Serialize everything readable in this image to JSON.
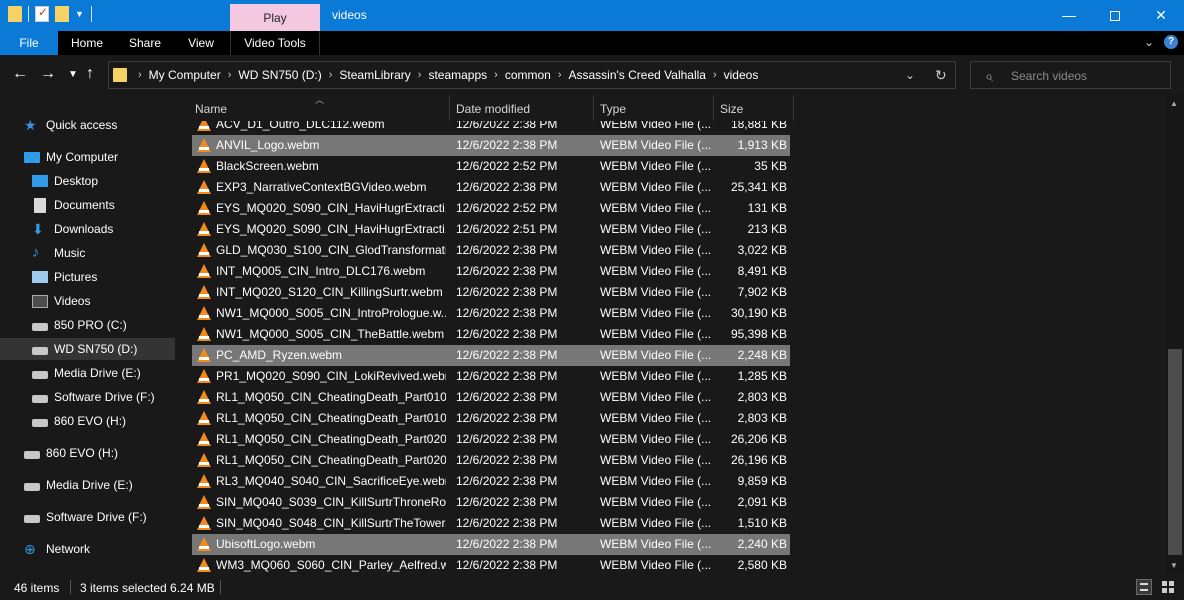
{
  "window": {
    "title": "videos",
    "context_tab": "Play",
    "min_label": "—",
    "close_label": "✕"
  },
  "ribbon": {
    "tabs": [
      "File",
      "Home",
      "Share",
      "View",
      "Video Tools"
    ]
  },
  "address": {
    "crumbs": [
      "My Computer",
      "WD SN750 (D:)",
      "SteamLibrary",
      "steamapps",
      "common",
      "Assassin's Creed Valhalla",
      "videos"
    ]
  },
  "search": {
    "placeholder": "Search videos"
  },
  "nav": {
    "quick_access": "Quick access",
    "my_computer": "My Computer",
    "desktop": "Desktop",
    "documents": "Documents",
    "downloads": "Downloads",
    "music": "Music",
    "pictures": "Pictures",
    "videos": "Videos",
    "drive_c": "850 PRO (C:)",
    "drive_d": "WD SN750 (D:)",
    "drive_e": "Media Drive (E:)",
    "drive_f": "Software Drive (F:)",
    "drive_h": "860 EVO (H:)",
    "ext_h": "860 EVO (H:)",
    "ext_e": "Media Drive (E:)",
    "ext_f": "Software Drive (F:)",
    "network": "Network"
  },
  "columns": {
    "name": "Name",
    "date": "Date modified",
    "type": "Type",
    "size": "Size"
  },
  "files": [
    {
      "name": "ACV_D1_Outro_DLC112.webm",
      "date": "12/6/2022 2:38 PM",
      "type": "WEBM Video File (...",
      "size": "18,881 KB",
      "selected": false
    },
    {
      "name": "ANVIL_Logo.webm",
      "date": "12/6/2022 2:38 PM",
      "type": "WEBM Video File (...",
      "size": "1,913 KB",
      "selected": true
    },
    {
      "name": "BlackScreen.webm",
      "date": "12/6/2022 2:52 PM",
      "type": "WEBM Video File (...",
      "size": "35 KB",
      "selected": false
    },
    {
      "name": "EXP3_NarrativeContextBGVideo.webm",
      "date": "12/6/2022 2:38 PM",
      "type": "WEBM Video File (...",
      "size": "25,341 KB",
      "selected": false
    },
    {
      "name": "EYS_MQ020_S090_CIN_HaviHugrExtracti...",
      "date": "12/6/2022 2:52 PM",
      "type": "WEBM Video File (...",
      "size": "131 KB",
      "selected": false
    },
    {
      "name": "EYS_MQ020_S090_CIN_HaviHugrExtracti...",
      "date": "12/6/2022 2:51 PM",
      "type": "WEBM Video File (...",
      "size": "213 KB",
      "selected": false
    },
    {
      "name": "GLD_MQ030_S100_CIN_GlodTransformati...",
      "date": "12/6/2022 2:38 PM",
      "type": "WEBM Video File (...",
      "size": "3,022 KB",
      "selected": false
    },
    {
      "name": "INT_MQ005_CIN_Intro_DLC176.webm",
      "date": "12/6/2022 2:38 PM",
      "type": "WEBM Video File (...",
      "size": "8,491 KB",
      "selected": false
    },
    {
      "name": "INT_MQ020_S120_CIN_KillingSurtr.webm",
      "date": "12/6/2022 2:38 PM",
      "type": "WEBM Video File (...",
      "size": "7,902 KB",
      "selected": false
    },
    {
      "name": "NW1_MQ000_S005_CIN_IntroPrologue.w...",
      "date": "12/6/2022 2:38 PM",
      "type": "WEBM Video File (...",
      "size": "30,190 KB",
      "selected": false
    },
    {
      "name": "NW1_MQ000_S005_CIN_TheBattle.webm",
      "date": "12/6/2022 2:38 PM",
      "type": "WEBM Video File (...",
      "size": "95,398 KB",
      "selected": false
    },
    {
      "name": "PC_AMD_Ryzen.webm",
      "date": "12/6/2022 2:38 PM",
      "type": "WEBM Video File (...",
      "size": "2,248 KB",
      "selected": true
    },
    {
      "name": "PR1_MQ020_S090_CIN_LokiRevived.webm",
      "date": "12/6/2022 2:38 PM",
      "type": "WEBM Video File (...",
      "size": "1,285 KB",
      "selected": false
    },
    {
      "name": "RL1_MQ050_CIN_CheatingDeath_Part010...",
      "date": "12/6/2022 2:38 PM",
      "type": "WEBM Video File (...",
      "size": "2,803 KB",
      "selected": false
    },
    {
      "name": "RL1_MQ050_CIN_CheatingDeath_Part010...",
      "date": "12/6/2022 2:38 PM",
      "type": "WEBM Video File (...",
      "size": "2,803 KB",
      "selected": false
    },
    {
      "name": "RL1_MQ050_CIN_CheatingDeath_Part020...",
      "date": "12/6/2022 2:38 PM",
      "type": "WEBM Video File (...",
      "size": "26,206 KB",
      "selected": false
    },
    {
      "name": "RL1_MQ050_CIN_CheatingDeath_Part020...",
      "date": "12/6/2022 2:38 PM",
      "type": "WEBM Video File (...",
      "size": "26,196 KB",
      "selected": false
    },
    {
      "name": "RL3_MQ040_S040_CIN_SacrificeEye.webm",
      "date": "12/6/2022 2:38 PM",
      "type": "WEBM Video File (...",
      "size": "9,859 KB",
      "selected": false
    },
    {
      "name": "SIN_MQ040_S039_CIN_KillSurtrThroneRo...",
      "date": "12/6/2022 2:38 PM",
      "type": "WEBM Video File (...",
      "size": "2,091 KB",
      "selected": false
    },
    {
      "name": "SIN_MQ040_S048_CIN_KillSurtrTheTower....",
      "date": "12/6/2022 2:38 PM",
      "type": "WEBM Video File (...",
      "size": "1,510 KB",
      "selected": false
    },
    {
      "name": "UbisoftLogo.webm",
      "date": "12/6/2022 2:38 PM",
      "type": "WEBM Video File (...",
      "size": "2,240 KB",
      "selected": true
    },
    {
      "name": "WM3_MQ060_S060_CIN_Parley_Aelfred.we...",
      "date": "12/6/2022 2:38 PM",
      "type": "WEBM Video File (...",
      "size": "2,580 KB",
      "selected": false
    }
  ],
  "status": {
    "item_count": "46 items",
    "selection": "3 items selected  6.24 MB"
  },
  "icons": {
    "file": "vlc-cone-icon",
    "quick_access": "star-icon",
    "network": "network-icon"
  },
  "colors": {
    "titlebar": "#0a7ad6",
    "context_tab": "#f5c8e1",
    "selection": "#777777",
    "vlc": "#f28b1c"
  }
}
